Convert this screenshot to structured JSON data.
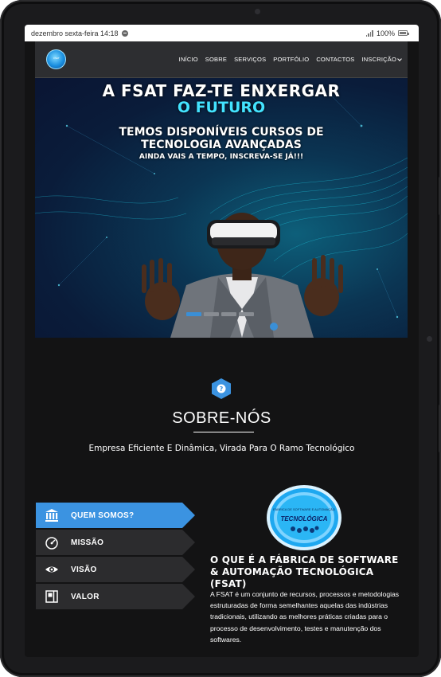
{
  "status_bar": {
    "datetime": "dezembro sexta-feira 14:18",
    "battery": "100%"
  },
  "header": {
    "logo_text": "FSAT",
    "nav": [
      {
        "label": "INÍCIO"
      },
      {
        "label": "SOBRE"
      },
      {
        "label": "SERVIÇOS"
      },
      {
        "label": "PORTFÓLIO"
      },
      {
        "label": "CONTACTOS"
      },
      {
        "label": "INSCRIÇÃO",
        "has_dropdown": true
      }
    ]
  },
  "hero": {
    "title_line1": "A FSAT FAZ-TE ENXERGAR",
    "title_line2": "O FUTURO",
    "subtitle_line1": "TEMOS DISPONÍVEIS CURSOS DE",
    "subtitle_line2": "TECNOLOGIA AVANÇADAS",
    "cta_text": "AINDA VAIS A TEMPO, INSCREVA-SE JÁ!!!",
    "slides_total": 4,
    "active_slide": 1
  },
  "about": {
    "icon": "question-icon",
    "title": "SOBRE-NÓS",
    "subtitle": "Empresa Eficiente E Dinâmica, Virada Para O Ramo Tecnológico",
    "tabs": [
      {
        "label": "QUEM SOMOS?",
        "icon": "bank-icon",
        "active": true
      },
      {
        "label": "MISSÃO",
        "icon": "gauge-icon",
        "active": false
      },
      {
        "label": "VISÃO",
        "icon": "eye-icon",
        "active": false
      },
      {
        "label": "VALOR",
        "icon": "layout-icon",
        "active": false
      }
    ],
    "badge_top": "FÁBRICA DE SOFTWARE E AUTOMAÇÃO",
    "badge_main": "TECNOLÓGICA",
    "content_title": "O QUE É A FÁBRICA DE SOFTWARE & AUTOMAÇÃO TECNOLÓGICA (FSAT)",
    "content_text": "A FSAT é um conjunto de recursos, processos e metodologias estruturadas de forma semelhantes aquelas das indústrias tradicionais, utilizando as melhores práticas criadas para o processo de desenvolvimento, testes e manutenção dos softwares."
  },
  "colors": {
    "accent": "#3b93e1",
    "hero_highlight": "#43e3ff",
    "background": "#131314",
    "tab_inactive": "#2c2c2e"
  }
}
